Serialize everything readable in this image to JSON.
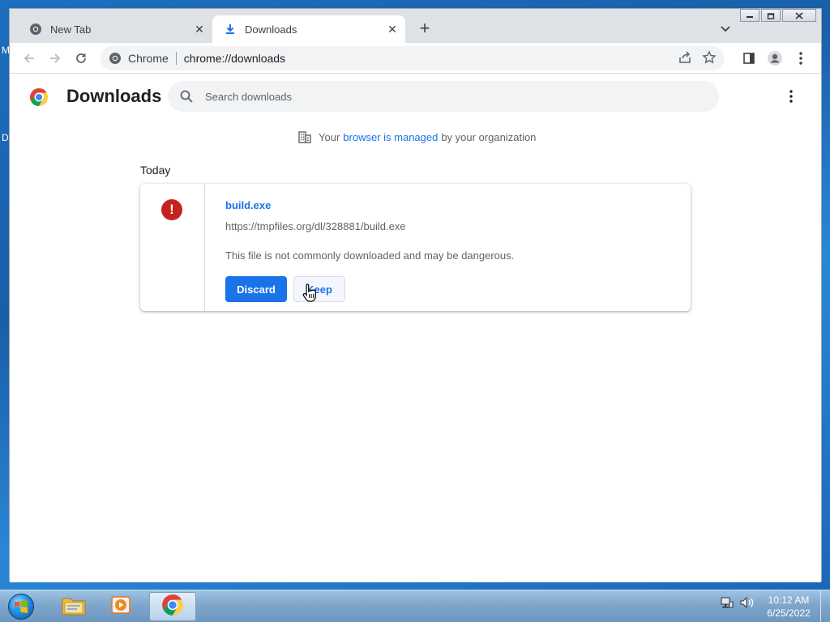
{
  "desktop": {
    "edge_letters": [
      "M",
      "D"
    ]
  },
  "window_controls": {
    "minimize": "minimize",
    "restore": "restore",
    "close": "close"
  },
  "tabs": [
    {
      "title": "New Tab",
      "icon": "chrome-icon",
      "active": false
    },
    {
      "title": "Downloads",
      "icon": "download-icon",
      "active": true
    }
  ],
  "omnibox": {
    "chip": "Chrome",
    "url": "chrome://downloads"
  },
  "page": {
    "title": "Downloads",
    "search_placeholder": "Search downloads",
    "managed": {
      "before": "Your",
      "link": "browser is managed",
      "after": "by your organization"
    },
    "date_label": "Today"
  },
  "download": {
    "file_name": "build.exe",
    "url": "https://tmpfiles.org/dl/328881/build.exe",
    "warning": "This file is not commonly downloaded and may be dangerous.",
    "discard_label": "Discard",
    "keep_label": "Keep"
  },
  "taskbar": {
    "items": [
      "windows-explorer",
      "media-player",
      "chrome"
    ],
    "time": "10:12 AM",
    "date": "6/25/2022"
  },
  "colors": {
    "accent": "#1a73e8",
    "danger": "#c5221f",
    "tabstrip": "#dee1e6"
  }
}
